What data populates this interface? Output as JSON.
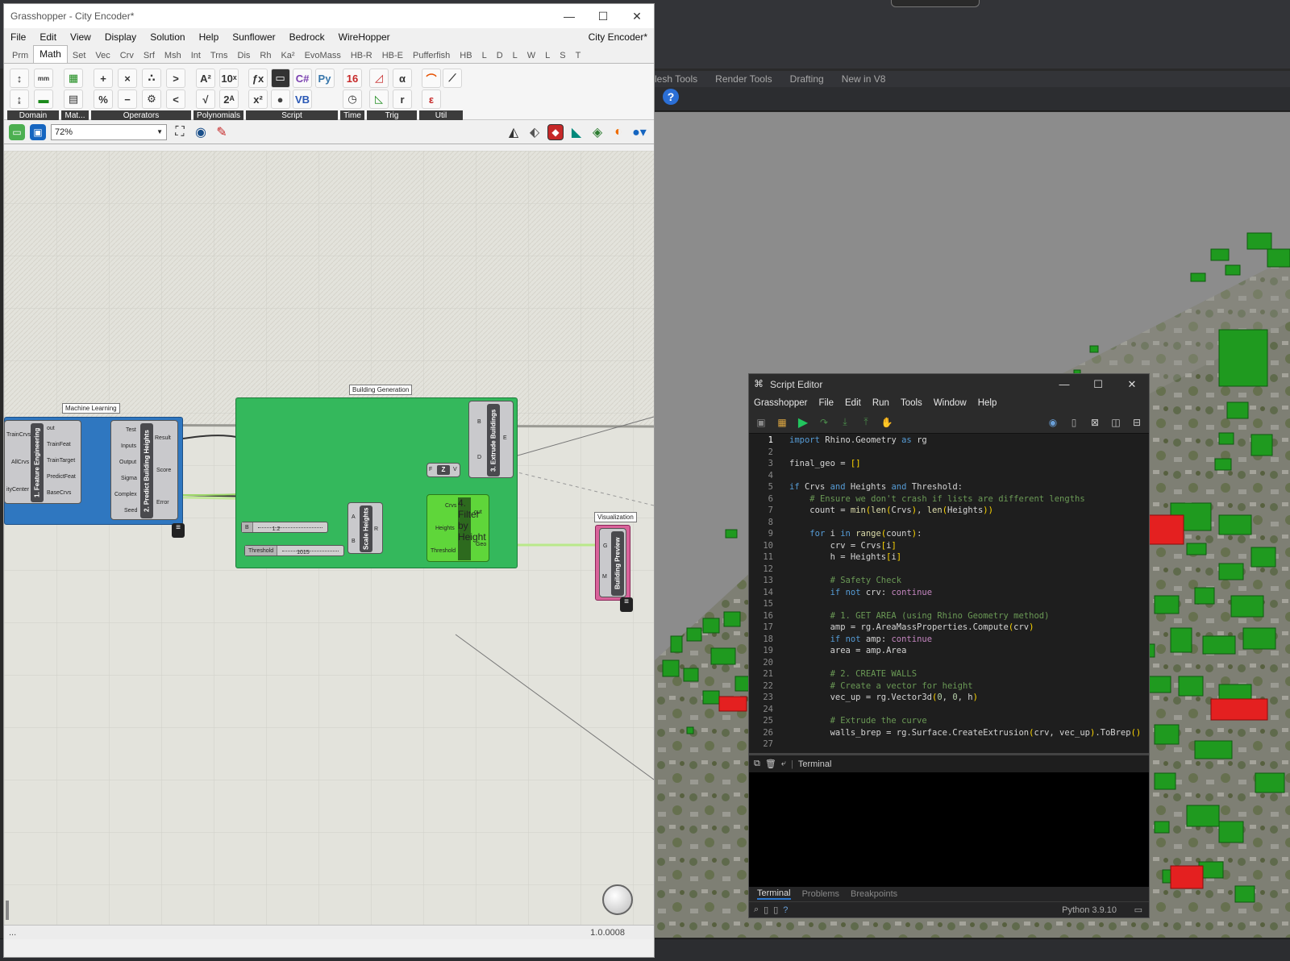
{
  "grasshopper": {
    "window_title": "Grasshopper - City Encoder*",
    "menu": [
      "File",
      "Edit",
      "View",
      "Display",
      "Solution",
      "Help",
      "Sunflower",
      "Bedrock",
      "WireHopper"
    ],
    "document_name": "City Encoder*",
    "tabs": [
      "Prm",
      "Math",
      "Set",
      "Vec",
      "Crv",
      "Srf",
      "Msh",
      "Int",
      "Trns",
      "Dis",
      "Rh",
      "Ka²",
      "EvoMass",
      "HB-R",
      "HB-E",
      "Pufferfish",
      "HB",
      "L",
      "D",
      "L",
      "W",
      "L",
      "S",
      "T"
    ],
    "active_tab": "Math",
    "ribbon_groups": [
      "Domain",
      "Mat...",
      "Operators",
      "Polynomials",
      "Script",
      "Time",
      "Trig",
      "Util"
    ],
    "zoom": "72%",
    "groups": {
      "ml_label": "Machine Learning",
      "build_label": "Building Generation",
      "vis_label": "Visualization"
    },
    "components": {
      "feature": {
        "name": "1. Feature Engineering",
        "inputs": [
          "TrainCrvs",
          "AllCrvs",
          "ityCenter"
        ],
        "outputs": [
          "out",
          "TrainFeat",
          "TrainTarget",
          "PredictFeat",
          "BaseCrvs"
        ]
      },
      "predict": {
        "name": "2. Predict Building Heights",
        "inputs": [
          "Test",
          "Inputs",
          "Output",
          "Sigma",
          "Complex",
          "Seed"
        ],
        "outputs": [
          "Result",
          "Score",
          "Error"
        ]
      },
      "extrude": {
        "name": "3. Extrude Buildings",
        "inputs": [
          "B",
          "D"
        ],
        "outputs": [
          "E"
        ]
      },
      "scale": {
        "name": "Scale Heights",
        "inputs": [
          "A",
          "B"
        ],
        "outputs": [
          "R"
        ]
      },
      "filter": {
        "name": "4. Filter by Height",
        "inputs": [
          "Crvs",
          "Heights",
          "Threshold"
        ],
        "outputs": [
          "out",
          "Geo"
        ]
      },
      "vector": {
        "name": "Z",
        "inputs": [
          "F"
        ],
        "outputs": [
          "V"
        ]
      },
      "preview": {
        "name": "Building Preview",
        "inputs": [
          "G",
          "M"
        ]
      }
    },
    "sliders": [
      {
        "label": "B",
        "value": "1.2"
      },
      {
        "label": "Threshold",
        "value": "1015"
      }
    ],
    "status_left": "...",
    "version": "1.0.0008"
  },
  "rhino": {
    "tabs": [
      "lesh Tools",
      "Render Tools",
      "Drafting",
      "New in V8"
    ]
  },
  "script_editor": {
    "title": "Script Editor",
    "menu": [
      "Grasshopper",
      "File",
      "Edit",
      "Run",
      "Tools",
      "Window",
      "Help"
    ],
    "terminal_label": "Terminal",
    "bottom_tabs": [
      "Terminal",
      "Problems",
      "Breakpoints"
    ],
    "python_version": "Python 3.9.10",
    "code": [
      {
        "n": "1",
        "t": "import Rhino.Geometry as rg"
      },
      {
        "n": "2",
        "t": ""
      },
      {
        "n": "3",
        "t": "final_geo = []"
      },
      {
        "n": "4",
        "t": ""
      },
      {
        "n": "5",
        "t": "if Crvs and Heights and Threshold:"
      },
      {
        "n": "6",
        "t": "    # Ensure we don't crash if lists are different lengths"
      },
      {
        "n": "7",
        "t": "    count = min(len(Crvs), len(Heights))"
      },
      {
        "n": "8",
        "t": ""
      },
      {
        "n": "9",
        "t": "    for i in range(count):"
      },
      {
        "n": "10",
        "t": "        crv = Crvs[i]"
      },
      {
        "n": "11",
        "t": "        h = Heights[i]"
      },
      {
        "n": "12",
        "t": ""
      },
      {
        "n": "13",
        "t": "        # Safety Check"
      },
      {
        "n": "14",
        "t": "        if not crv: continue"
      },
      {
        "n": "15",
        "t": ""
      },
      {
        "n": "16",
        "t": "        # 1. GET AREA (using Rhino Geometry method)"
      },
      {
        "n": "17",
        "t": "        amp = rg.AreaMassProperties.Compute(crv)"
      },
      {
        "n": "18",
        "t": "        if not amp: continue"
      },
      {
        "n": "19",
        "t": "        area = amp.Area"
      },
      {
        "n": "20",
        "t": ""
      },
      {
        "n": "21",
        "t": "        # 2. CREATE WALLS"
      },
      {
        "n": "22",
        "t": "        # Create a vector for height"
      },
      {
        "n": "23",
        "t": "        vec_up = rg.Vector3d(0, 0, h)"
      },
      {
        "n": "24",
        "t": ""
      },
      {
        "n": "25",
        "t": "        # Extrude the curve"
      },
      {
        "n": "26",
        "t": "        walls_brep = rg.Surface.CreateExtrusion(crv, vec_up).ToBrep()"
      },
      {
        "n": "27",
        "t": ""
      }
    ]
  }
}
